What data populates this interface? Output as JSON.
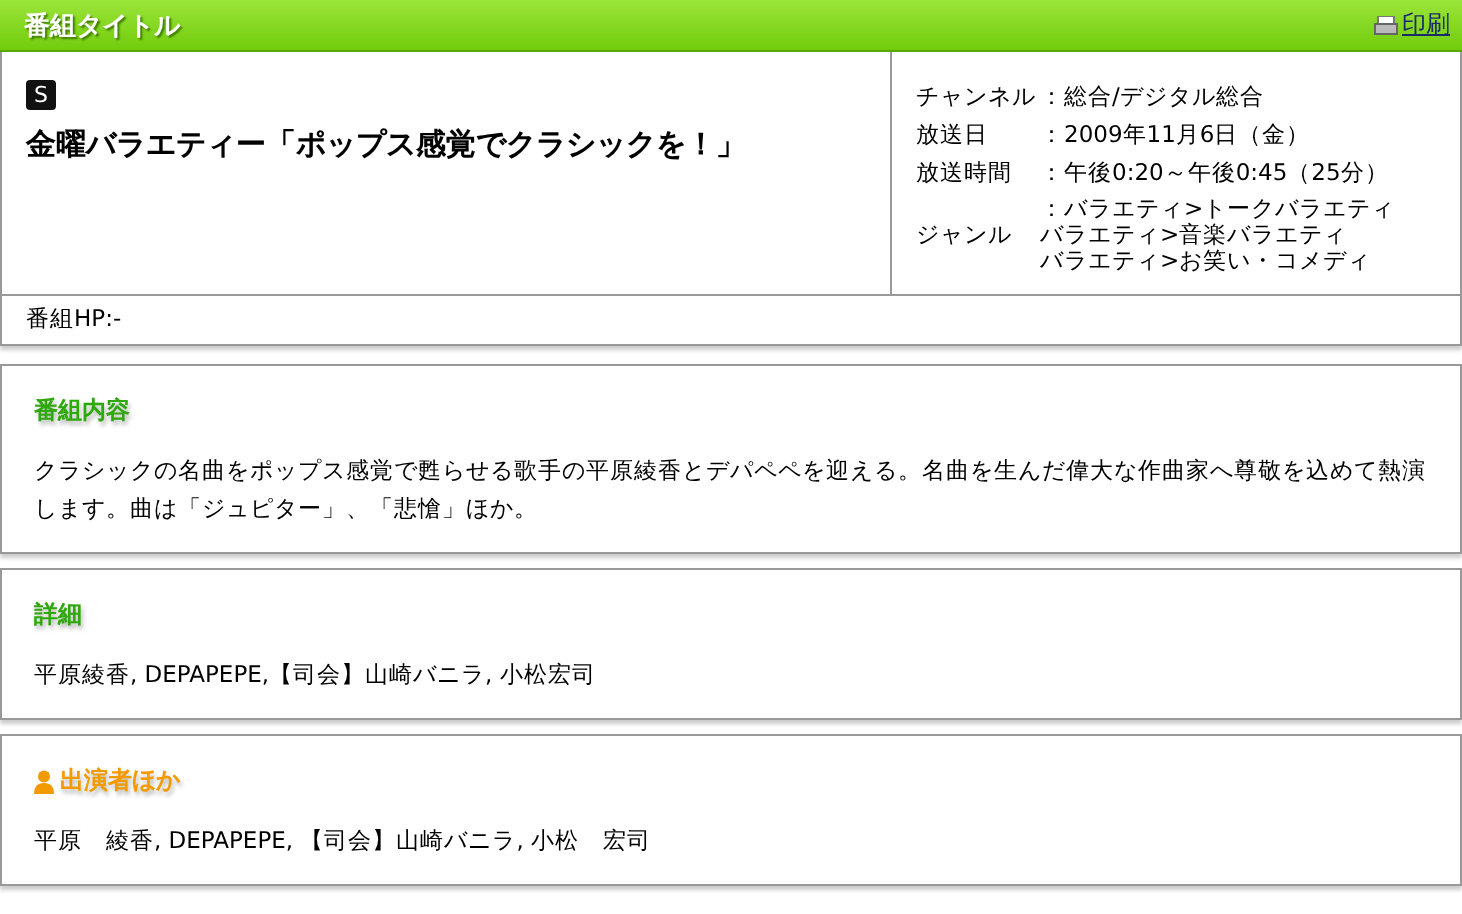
{
  "header": {
    "title": "番組タイトル",
    "print_link": "印刷"
  },
  "program": {
    "badge": "S",
    "title": "金曜バラエティー「ポップス感覚でクラシックを！」",
    "info": [
      {
        "label": "チャンネル",
        "value": [
          "：総合/デジタル総合"
        ]
      },
      {
        "label": "放送日",
        "value": [
          "：2009年11月6日（金）"
        ]
      },
      {
        "label": "放送時間",
        "value": [
          "：午後0:20～午後0:45（25分）"
        ]
      },
      {
        "label": "ジャンル",
        "value": [
          "：バラエティ>トークバラエティ",
          "バラエティ>音楽バラエティ",
          "バラエティ>お笑い・コメディ"
        ]
      }
    ],
    "homepage": "番組HP:-"
  },
  "sections": [
    {
      "kind": "content",
      "heading": "番組内容",
      "text": "クラシックの名曲をポップス感覚で甦らせる歌手の平原綾香とデパペペを迎える。名曲を生んだ偉大な作曲家へ尊敬を込めて熱演します。曲は「ジュピター」、「悲愴」ほか。"
    },
    {
      "kind": "details",
      "heading": "詳細",
      "text": "平原綾香, DEPAPEPE,【司会】山崎バニラ, 小松宏司"
    },
    {
      "kind": "performers",
      "heading": "出演者ほか",
      "text": "平原　綾香,  DEPAPEPE, 【司会】山崎バニラ,  小松　宏司"
    }
  ]
}
